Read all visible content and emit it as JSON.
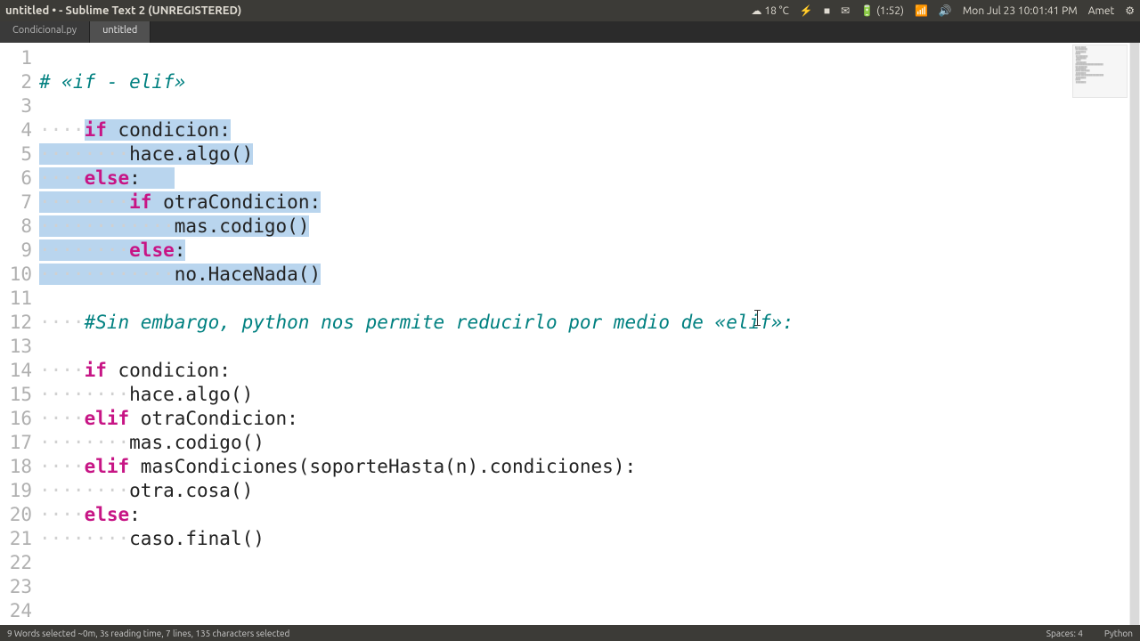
{
  "window": {
    "title": "untitled • - Sublime Text 2 (UNREGISTERED)"
  },
  "systray": {
    "temp": "18 °C",
    "battery": "(1:52)",
    "datetime": "Mon Jul 23 10:01:41 PM",
    "user": "Amet"
  },
  "tabs": [
    {
      "label": "Condicional.py",
      "active": false
    },
    {
      "label": "untitled",
      "active": true
    }
  ],
  "code": {
    "lines": [
      {
        "n": 1,
        "segments": []
      },
      {
        "n": 2,
        "segments": [
          {
            "t": "# «if - elif»",
            "c": "cm"
          }
        ]
      },
      {
        "n": 3,
        "segments": []
      },
      {
        "n": 4,
        "segments": [
          {
            "t": "····",
            "c": "ws"
          },
          {
            "t": "if",
            "c": "kw sel"
          },
          {
            "t": " condicion:",
            "c": "sel"
          }
        ]
      },
      {
        "n": 5,
        "segments": [
          {
            "t": "····",
            "c": "ws sel"
          },
          {
            "t": "····",
            "c": "ws sel"
          },
          {
            "t": "hace.algo()",
            "c": "sel"
          }
        ]
      },
      {
        "n": 6,
        "segments": [
          {
            "t": "····",
            "c": "ws sel"
          },
          {
            "t": "else",
            "c": "kw sel"
          },
          {
            "t": ":",
            "c": "sel"
          },
          {
            "t": "   ",
            "c": "sel"
          }
        ]
      },
      {
        "n": 7,
        "segments": [
          {
            "t": "····",
            "c": "ws sel"
          },
          {
            "t": "····",
            "c": "ws sel"
          },
          {
            "t": "if",
            "c": "kw sel"
          },
          {
            "t": " otraCondicion:",
            "c": "sel"
          }
        ]
      },
      {
        "n": 8,
        "segments": [
          {
            "t": "····",
            "c": "ws sel"
          },
          {
            "t": "····",
            "c": "ws sel"
          },
          {
            "t": "····",
            "c": "ws sel"
          },
          {
            "t": "mas.codigo()",
            "c": "sel"
          }
        ]
      },
      {
        "n": 9,
        "segments": [
          {
            "t": "····",
            "c": "ws sel"
          },
          {
            "t": "····",
            "c": "ws sel"
          },
          {
            "t": "else",
            "c": "kw sel"
          },
          {
            "t": ":",
            "c": "sel"
          }
        ]
      },
      {
        "n": 10,
        "segments": [
          {
            "t": "····",
            "c": "ws sel"
          },
          {
            "t": "····",
            "c": "ws sel"
          },
          {
            "t": "····",
            "c": "ws sel"
          },
          {
            "t": "no.HaceNada()",
            "c": "sel"
          }
        ]
      },
      {
        "n": 11,
        "segments": []
      },
      {
        "n": 12,
        "segments": [
          {
            "t": "····",
            "c": "ws"
          },
          {
            "t": "#Sin embargo, python nos permite reducirlo por medio de «elif»:",
            "c": "cm"
          }
        ]
      },
      {
        "n": 13,
        "segments": []
      },
      {
        "n": 14,
        "segments": [
          {
            "t": "····",
            "c": "ws"
          },
          {
            "t": "if",
            "c": "kw"
          },
          {
            "t": " condicion:"
          }
        ]
      },
      {
        "n": 15,
        "segments": [
          {
            "t": "····",
            "c": "ws"
          },
          {
            "t": "····",
            "c": "ws"
          },
          {
            "t": "hace.algo()"
          }
        ]
      },
      {
        "n": 16,
        "segments": [
          {
            "t": "····",
            "c": "ws"
          },
          {
            "t": "elif",
            "c": "kw"
          },
          {
            "t": " otraCondicion:"
          }
        ]
      },
      {
        "n": 17,
        "segments": [
          {
            "t": "····",
            "c": "ws"
          },
          {
            "t": "····",
            "c": "ws"
          },
          {
            "t": "mas.codigo()"
          }
        ]
      },
      {
        "n": 18,
        "segments": [
          {
            "t": "····",
            "c": "ws"
          },
          {
            "t": "elif",
            "c": "kw"
          },
          {
            "t": " masCondiciones(soporteHasta(n).condiciones):"
          }
        ]
      },
      {
        "n": 19,
        "segments": [
          {
            "t": "····",
            "c": "ws"
          },
          {
            "t": "····",
            "c": "ws"
          },
          {
            "t": "otra.cosa()"
          }
        ]
      },
      {
        "n": 20,
        "segments": [
          {
            "t": "····",
            "c": "ws"
          },
          {
            "t": "else",
            "c": "kw"
          },
          {
            "t": ":"
          }
        ]
      },
      {
        "n": 21,
        "segments": [
          {
            "t": "····",
            "c": "ws"
          },
          {
            "t": "····",
            "c": "ws"
          },
          {
            "t": "caso.final()"
          }
        ]
      },
      {
        "n": 22,
        "segments": []
      },
      {
        "n": 23,
        "segments": []
      },
      {
        "n": 24,
        "segments": []
      }
    ]
  },
  "statusbar": {
    "left": "9 Words selected ~0m, 3s reading time, 7 lines, 135 characters selected",
    "spaces": "Spaces: 4",
    "lang": "Python"
  }
}
